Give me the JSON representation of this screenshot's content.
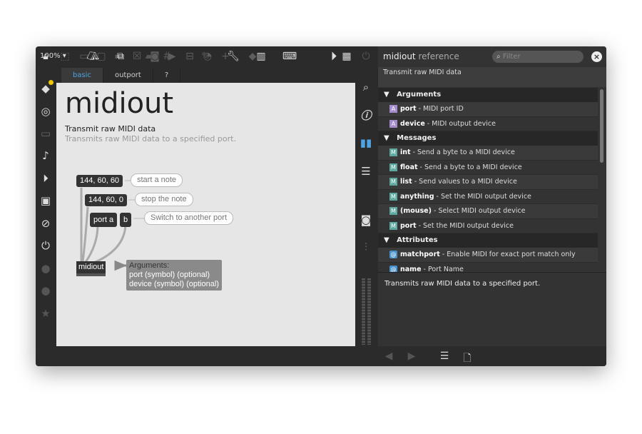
{
  "toolbar": {
    "zoom": "100%",
    "zoom_arrow": "▾"
  },
  "tabs": [
    {
      "label": "basic"
    },
    {
      "label": "outport"
    },
    {
      "label": "?"
    }
  ],
  "patch": {
    "title": "midiout",
    "subtitle": "Transmit raw MIDI data",
    "description": "Transmits raw MIDI data to a specified port.",
    "msg1": "144, 60, 60",
    "msg2": "144, 60, 0",
    "msg3": "port a",
    "msg4": "b",
    "cmt1": "start a note",
    "cmt2": "stop the note",
    "cmt3": "Switch to another port",
    "object": "midiout",
    "args_title": "Arguments:",
    "args_line1": "port (symbol) (optional)",
    "args_line2": "device (symbol) (optional)"
  },
  "reference": {
    "title": "midiout",
    "title_suffix": "reference",
    "filter_placeholder": "Filter",
    "digest": "Transmit raw MIDI data",
    "sections": {
      "arguments": "Arguments",
      "messages": "Messages",
      "attributes": "Attributes"
    },
    "arguments": [
      {
        "badge": "A",
        "name": "port",
        "desc": " - MIDI port ID"
      },
      {
        "badge": "A",
        "name": "device",
        "desc": " - MIDI output device"
      }
    ],
    "messages": [
      {
        "badge": "M",
        "name": "int",
        "desc": " - Send a byte to a MIDI device"
      },
      {
        "badge": "M",
        "name": "float",
        "desc": " - Send a byte to a MIDI device"
      },
      {
        "badge": "M",
        "name": "list",
        "desc": " - Send values to a MIDI device"
      },
      {
        "badge": "M",
        "name": "anything",
        "desc": " - Set the MIDI output device"
      },
      {
        "badge": "M",
        "name": "(mouse)",
        "desc": " - Select MIDI output device"
      },
      {
        "badge": "M",
        "name": "port",
        "desc": " - Set the MIDI output device"
      }
    ],
    "attributes": [
      {
        "badge": "@",
        "name": "matchport",
        "desc": " - Enable MIDI for exact port match only"
      },
      {
        "badge": "@",
        "name": "name",
        "desc": " - Port Name"
      }
    ],
    "footer": "Transmits raw MIDI data to a specified port."
  },
  "colors": {
    "accent": "#4fa3e0",
    "arg_badge": "#a58ccc",
    "msg_badge": "#5fa8a0",
    "attr_badge": "#4a90d0"
  }
}
